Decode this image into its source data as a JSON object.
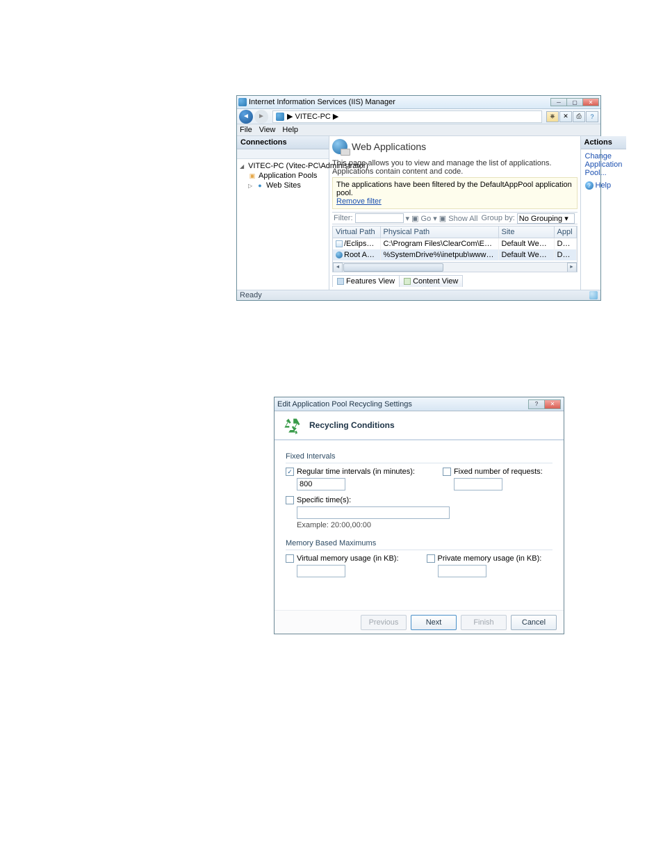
{
  "iis": {
    "win_title": "Internet Information Services (IIS) Manager",
    "breadcrumb": "▶ VITEC-PC ▶",
    "menubar": {
      "file": "File",
      "view": "View",
      "help": "Help"
    },
    "connections": {
      "header": "Connections",
      "server_label": "VITEC-PC (Vitec-PC\\Administrator)",
      "app_pools": "Application Pools",
      "web_sites": "Web Sites"
    },
    "main": {
      "title": "Web Applications",
      "desc": "This page allows you to view and manage the list of applications. Applications contain content and code.",
      "filter_msg": "The applications have been filtered by the DefaultAppPool application pool.",
      "remove_filter": "Remove filter",
      "filter_label": "Filter:",
      "go_label": "Go",
      "show_all": "Show All",
      "group_by_label": "Group by:",
      "group_by_value": "No Grouping",
      "columns": {
        "vpath": "Virtual Path",
        "ppath": "Physical Path",
        "site": "Site",
        "pool": "Appl"
      },
      "rows": [
        {
          "vpath": "/EclipseServer",
          "ppath": "C:\\Program Files\\ClearCom\\Eclipse Conf...",
          "site": "Default Web Site",
          "pool": "Defa"
        },
        {
          "vpath": "Root Application",
          "ppath": "%SystemDrive%\\inetpub\\wwwroot",
          "site": "Default Web Site",
          "pool": "Defa"
        }
      ],
      "tabs": {
        "features": "Features View",
        "content": "Content View"
      }
    },
    "actions": {
      "header": "Actions",
      "change_pool": "Change Application Pool...",
      "help": "Help"
    },
    "status": "Ready"
  },
  "dlg": {
    "title": "Edit Application Pool Recycling Settings",
    "banner_title": "Recycling Conditions",
    "fixed_intervals_label": "Fixed Intervals",
    "regular_label": "Regular time intervals (in minutes):",
    "regular_value": "800",
    "fixed_requests_label": "Fixed number of requests:",
    "specific_times_label": "Specific time(s):",
    "specific_times_hint": "Example: 20:00,00:00",
    "mem_label": "Memory Based Maximums",
    "virtual_label": "Virtual memory usage (in KB):",
    "private_label": "Private memory usage (in KB):",
    "buttons": {
      "prev": "Previous",
      "next": "Next",
      "finish": "Finish",
      "cancel": "Cancel"
    }
  }
}
